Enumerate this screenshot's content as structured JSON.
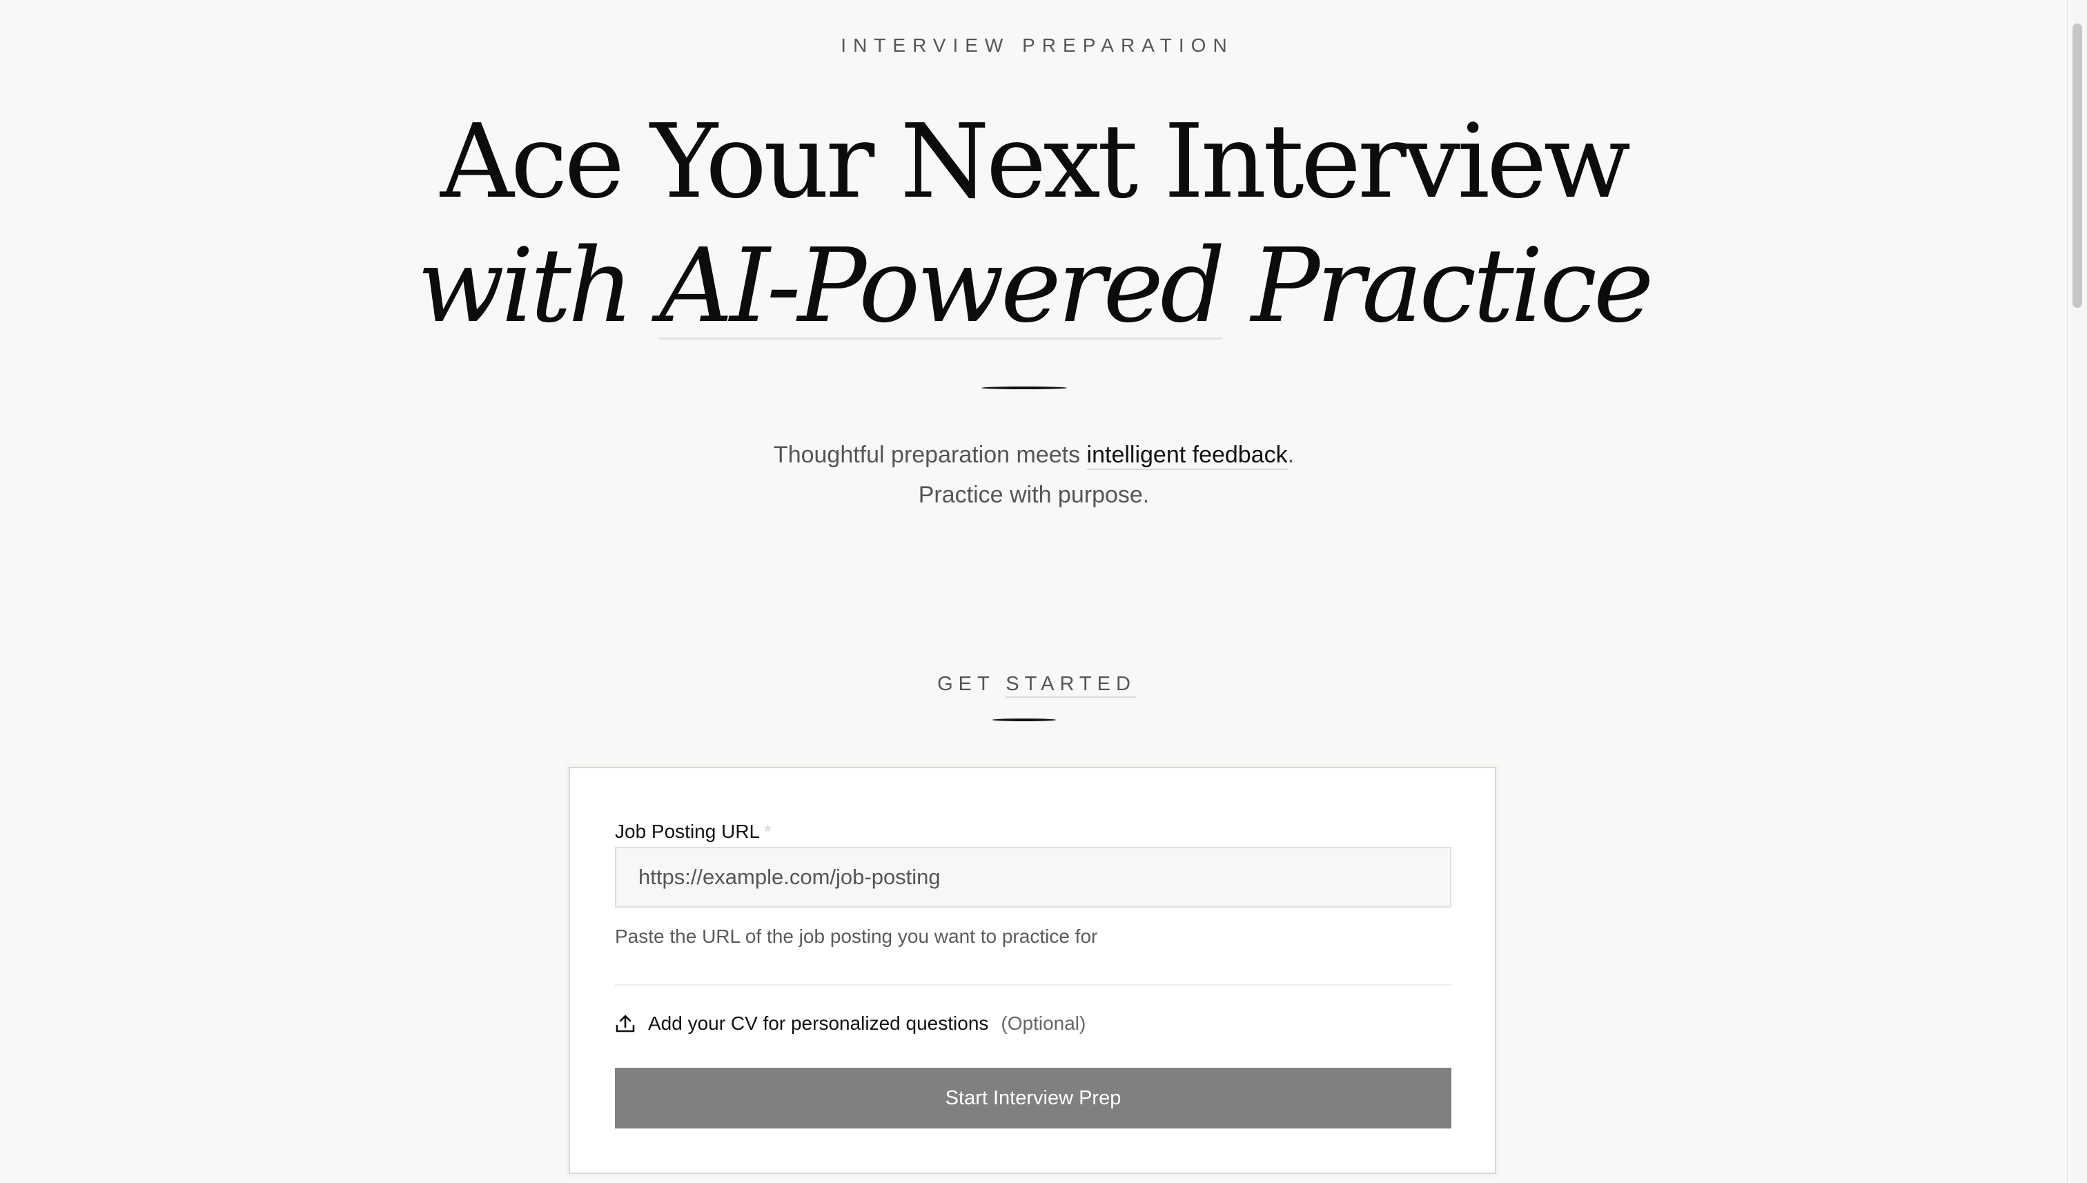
{
  "hero": {
    "eyebrow": "INTERVIEW PREPARATION",
    "headline_line1": "Ace Your Next Interview",
    "headline_line2_prefix": "with ",
    "headline_line2_emphasis": "AI-Powered",
    "headline_line2_suffix": " Practice",
    "subtitle_prefix": "Thoughtful preparation meets ",
    "subtitle_emphasis": "intelligent feedback",
    "subtitle_period": ".",
    "subtitle_line2": "Practice with purpose."
  },
  "get_started": {
    "label_word1": "GET ",
    "label_word2": "STARTED"
  },
  "form": {
    "url_label": "Job Posting URL",
    "url_required_marker": "*",
    "url_placeholder": "https://example.com/job-posting",
    "url_value": "",
    "url_help": "Paste the URL of the job posting you want to practice for",
    "cv_icon": "upload-icon",
    "cv_label": "Add your CV for personalized questions",
    "cv_optional": "(Optional)",
    "submit_label": "Start Interview Prep",
    "submit_color": "#808080"
  },
  "colors": {
    "background": "#f8f8f7",
    "text": "#111111",
    "muted": "#555555"
  }
}
